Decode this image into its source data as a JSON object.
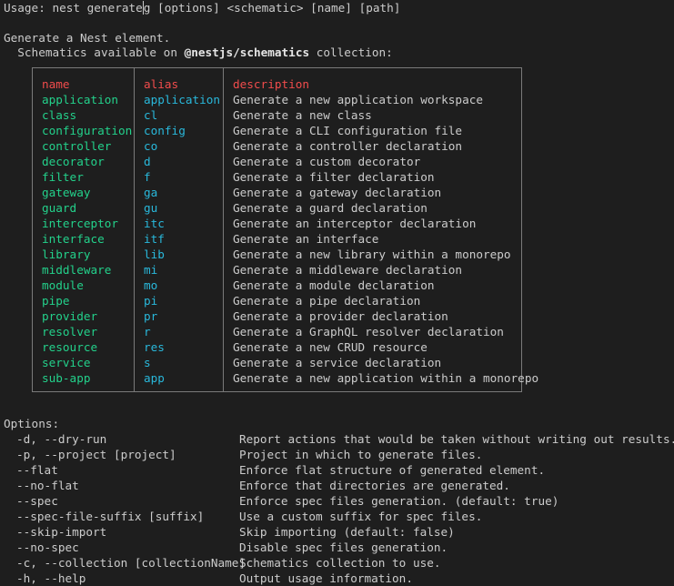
{
  "usage": {
    "before_cursor": "Usage: nest generate",
    "after_cursor": "g [options] <schematic> [name] [path]"
  },
  "intro": {
    "line1": "Generate a Nest element.",
    "line2_prefix": "  Schematics available on ",
    "line2_bold": "@nestjs/schematics",
    "line2_suffix": " collection:"
  },
  "table": {
    "headers": {
      "name": "name",
      "alias": "alias",
      "description": "description"
    },
    "rows": [
      {
        "name": "application",
        "alias": "application",
        "description": "Generate a new application workspace"
      },
      {
        "name": "class",
        "alias": "cl",
        "description": "Generate a new class"
      },
      {
        "name": "configuration",
        "alias": "config",
        "description": "Generate a CLI configuration file"
      },
      {
        "name": "controller",
        "alias": "co",
        "description": "Generate a controller declaration"
      },
      {
        "name": "decorator",
        "alias": "d",
        "description": "Generate a custom decorator"
      },
      {
        "name": "filter",
        "alias": "f",
        "description": "Generate a filter declaration"
      },
      {
        "name": "gateway",
        "alias": "ga",
        "description": "Generate a gateway declaration"
      },
      {
        "name": "guard",
        "alias": "gu",
        "description": "Generate a guard declaration"
      },
      {
        "name": "interceptor",
        "alias": "itc",
        "description": "Generate an interceptor declaration"
      },
      {
        "name": "interface",
        "alias": "itf",
        "description": "Generate an interface"
      },
      {
        "name": "library",
        "alias": "lib",
        "description": "Generate a new library within a monorepo"
      },
      {
        "name": "middleware",
        "alias": "mi",
        "description": "Generate a middleware declaration"
      },
      {
        "name": "module",
        "alias": "mo",
        "description": "Generate a module declaration"
      },
      {
        "name": "pipe",
        "alias": "pi",
        "description": "Generate a pipe declaration"
      },
      {
        "name": "provider",
        "alias": "pr",
        "description": "Generate a provider declaration"
      },
      {
        "name": "resolver",
        "alias": "r",
        "description": "Generate a GraphQL resolver declaration"
      },
      {
        "name": "resource",
        "alias": "res",
        "description": "Generate a new CRUD resource"
      },
      {
        "name": "service",
        "alias": "s",
        "description": "Generate a service declaration"
      },
      {
        "name": "sub-app",
        "alias": "app",
        "description": "Generate a new application within a monorepo"
      }
    ]
  },
  "options": {
    "heading": "Options:",
    "items": [
      {
        "flag": "-d, --dry-run",
        "description": "Report actions that would be taken without writing out results."
      },
      {
        "flag": "-p, --project [project]",
        "description": "Project in which to generate files."
      },
      {
        "flag": "--flat",
        "description": "Enforce flat structure of generated element."
      },
      {
        "flag": "--no-flat",
        "description": "Enforce that directories are generated."
      },
      {
        "flag": "--spec",
        "description": "Enforce spec files generation. (default: true)"
      },
      {
        "flag": "--spec-file-suffix [suffix]",
        "description": "Use a custom suffix for spec files."
      },
      {
        "flag": "--skip-import",
        "description": "Skip importing (default: false)"
      },
      {
        "flag": "--no-spec",
        "description": "Disable spec files generation."
      },
      {
        "flag": "-c, --collection [collectionName]",
        "description": "Schematics collection to use."
      },
      {
        "flag": "-h, --help",
        "description": "Output usage information."
      }
    ]
  },
  "colors": {
    "background": "#1e1e1e",
    "text": "#cccccc",
    "name_column": "#23d18b",
    "alias_column": "#29b8db",
    "header": "#f14c4c",
    "border": "#7a7a7a"
  }
}
